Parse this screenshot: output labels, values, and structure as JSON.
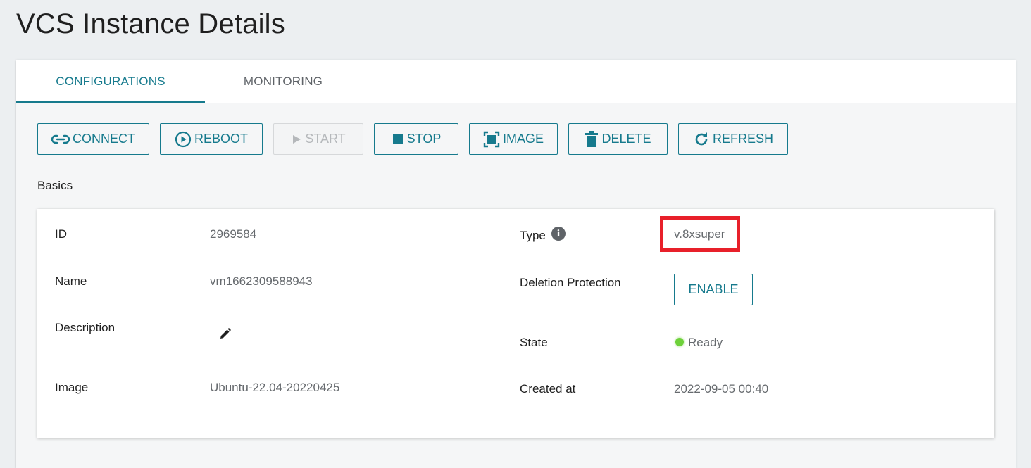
{
  "page": {
    "title": "VCS Instance Details"
  },
  "tabs": [
    {
      "label": "CONFIGURATIONS",
      "active": true
    },
    {
      "label": "MONITORING",
      "active": false
    }
  ],
  "toolbar": {
    "connect": "CONNECT",
    "reboot": "REBOOT",
    "start": "START",
    "stop": "STOP",
    "image": "IMAGE",
    "delete": "DELETE",
    "refresh": "REFRESH"
  },
  "basics": {
    "section_label": "Basics",
    "id_label": "ID",
    "id_value": "2969584",
    "name_label": "Name",
    "name_value": "vm1662309588943",
    "description_label": "Description",
    "image_label": "Image",
    "image_value": "Ubuntu-22.04-20220425",
    "type_label": "Type",
    "type_value": "v.8xsuper",
    "deletion_protection_label": "Deletion Protection",
    "deletion_protection_button": "ENABLE",
    "state_label": "State",
    "state_value": "Ready",
    "created_at_label": "Created at",
    "created_at_value": "2022-09-05 00:40"
  },
  "colors": {
    "accent": "#167a8d",
    "highlight": "#e8202a",
    "status_ready": "#6ed13a"
  },
  "icons": {
    "connect": "link-icon",
    "reboot": "play-circle-icon",
    "start": "play-icon",
    "stop": "stop-icon",
    "image": "image-frame-icon",
    "delete": "trash-icon",
    "refresh": "refresh-icon",
    "type_info": "info-icon",
    "description_edit": "pencil-icon",
    "state": "status-dot-icon"
  }
}
